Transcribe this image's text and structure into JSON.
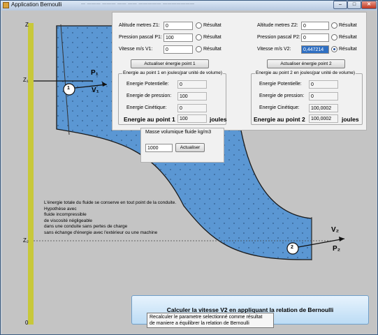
{
  "window": {
    "title": "Application Bernoulli",
    "faint_text": "— ——— ——— —— —— ————— ———————",
    "min_glyph": "–",
    "max_glyph": "□",
    "close_glyph": "✕"
  },
  "diagram": {
    "z_axis": "Z",
    "z1": "Z₁",
    "z2": "Z₂",
    "zero": "0",
    "p1": "P₁",
    "v1": "V₁",
    "point1": "1",
    "v2": "V₂",
    "p2": "P₂",
    "point2": "2",
    "description": [
      "L'énergie totale du fluide se conserve en tout point de la conduite.",
      "Hypothèse avec",
      "fluide incompressible",
      "de viscosité négligeable",
      "dans une conduite sans pertes de charge",
      "sans échange d'énergie avec l'extérieur ou une machine"
    ]
  },
  "point1": {
    "altitude_label": "Altitude metres Z1:",
    "altitude_value": "0",
    "pressure_label": "Pression pascal P1:",
    "pressure_value": "100",
    "speed_label": "Vitesse m/s V1:",
    "speed_value": "0",
    "radio_label": "Résultat",
    "update_button": "Actualiser énergie point 1",
    "group_title": "Energie au point 1 en joules(par unité de volume)",
    "potential_label": "Energie Potentielle:",
    "potential_value": "0",
    "pressure_energy_label": "Energie de pression:",
    "pressure_energy_value": "100",
    "kinetic_label": "Energie Cinétique:",
    "kinetic_value": "0",
    "total_label": "Energie au point 1",
    "total_value": "100",
    "unit": "joules"
  },
  "point2": {
    "altitude_label": "Altitude metres Z2:",
    "altitude_value": "0",
    "pressure_label": "Pression pascal P2:",
    "pressure_value": "0",
    "speed_label": "Vitesse m/s V2:",
    "speed_value": "0,447214",
    "radio_label": "Résultat",
    "update_button": "Actualiser énergie point 2",
    "group_title": "Energie au point 2 en joules(par unité de volume)",
    "potential_label": "Energie Potentielle:",
    "potential_value": "0",
    "pressure_energy_label": "Energie de pression:",
    "pressure_energy_value": "0",
    "kinetic_label": "Energie Cinétique:",
    "kinetic_value": "100,0002",
    "total_label": "Energie au point 2",
    "total_value": "100,0002",
    "unit": "joules"
  },
  "density": {
    "title": "Masse volumique fluide kg/m3",
    "value": "1000",
    "button": "Actualiser"
  },
  "calculate_button": "Calculer la vitesse V2 en appliquant la relation de Bernoulli",
  "tooltip": {
    "line1": "Recalculer le parametre selectionné comme résultat",
    "line2": "de maniere a équilibrer la relation de Bernoulli"
  },
  "colors": {
    "fluid": "#5b97d3",
    "axis": "#c8c83a",
    "window_bg": "#f1f1f1"
  }
}
